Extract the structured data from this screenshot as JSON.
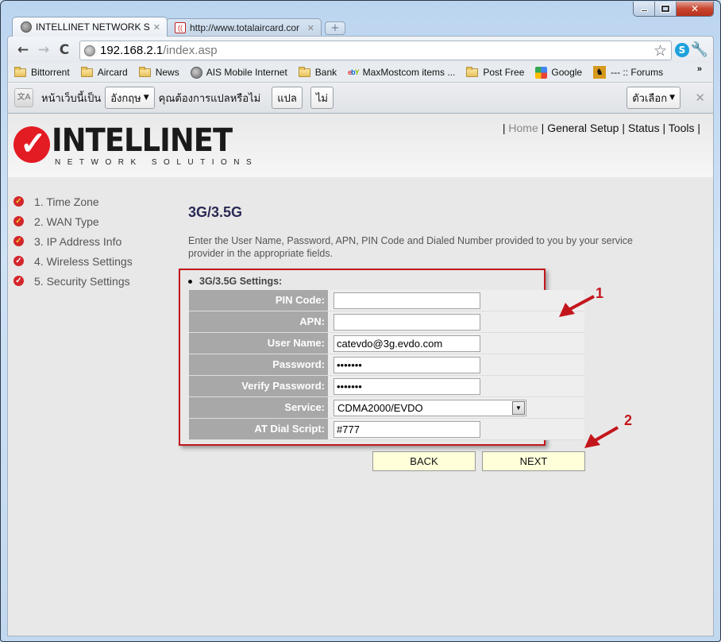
{
  "window": {
    "controls": {
      "minimize": "minimize",
      "maximize": "maximize",
      "close": "close"
    }
  },
  "tabs": [
    {
      "title": "INTELLINET NETWORK SOL",
      "icon": "globe-icon",
      "active": true
    },
    {
      "title": "http://www.totalaircard.cor",
      "icon": "totalaircard-icon",
      "active": false
    }
  ],
  "toolbar": {
    "url_host": "192.168.2.1",
    "url_path": "/index.asp"
  },
  "bookmarks": [
    {
      "label": "Bittorrent",
      "icon": "folder-icon"
    },
    {
      "label": "Aircard",
      "icon": "folder-icon"
    },
    {
      "label": "News",
      "icon": "folder-icon"
    },
    {
      "label": "AIS Mobile Internet",
      "icon": "globe-icon"
    },
    {
      "label": "Bank",
      "icon": "folder-icon"
    },
    {
      "label": "MaxMostcom items ...",
      "icon": "ebay-icon"
    },
    {
      "label": "Post Free",
      "icon": "folder-icon"
    },
    {
      "label": "Google",
      "icon": "google-icon"
    },
    {
      "label": "--- :: Forums",
      "icon": "forum-icon"
    }
  ],
  "translate_bar": {
    "prefix": "หน้าเว็บนี้เป็น",
    "language": "อังกฤษ",
    "question": "คุณต้องการแปลหรือไม่",
    "translate_button": "แปล",
    "no_button": "ไม่",
    "options_button": "ตัวเลือก"
  },
  "page": {
    "logo": {
      "word": "INTELLINET",
      "sub": "NETWORK SOLUTIONS"
    },
    "top_nav": [
      "Home",
      "General Setup",
      "Status",
      "Tools"
    ],
    "sidebar": [
      {
        "label": "1. Time Zone",
        "done": true
      },
      {
        "label": "2. WAN Type",
        "done": true
      },
      {
        "label": "3. IP Address Info",
        "done": true
      },
      {
        "label": "4. Wireless Settings",
        "done": false
      },
      {
        "label": "5. Security Settings",
        "done": false
      }
    ],
    "title": "3G/3.5G",
    "description": "Enter the User Name, Password, APN, PIN Code and Dialed Number provided to you by your service provider in the appropriate fields.",
    "settings_title": "3G/3.5G Settings:",
    "fields": [
      {
        "label": "PIN Code:",
        "type": "text",
        "value": ""
      },
      {
        "label": "APN:",
        "type": "text",
        "value": ""
      },
      {
        "label": "User Name:",
        "type": "text",
        "value": "catevdo@3g.evdo.com"
      },
      {
        "label": "Password:",
        "type": "password",
        "value": "•••••••"
      },
      {
        "label": "Verify Password:",
        "type": "password",
        "value": "•••••••"
      },
      {
        "label": "Service:",
        "type": "select",
        "value": "CDMA2000/EVDO"
      },
      {
        "label": "AT Dial Script:",
        "type": "text",
        "value": "#777"
      }
    ],
    "back_button": "BACK",
    "next_button": "NEXT"
  },
  "annotations": {
    "one": "1",
    "two": "2"
  },
  "colors": {
    "accent_red": "#c3161c",
    "button_bg": "#ffffda",
    "label_bg": "#a8a8a8"
  }
}
